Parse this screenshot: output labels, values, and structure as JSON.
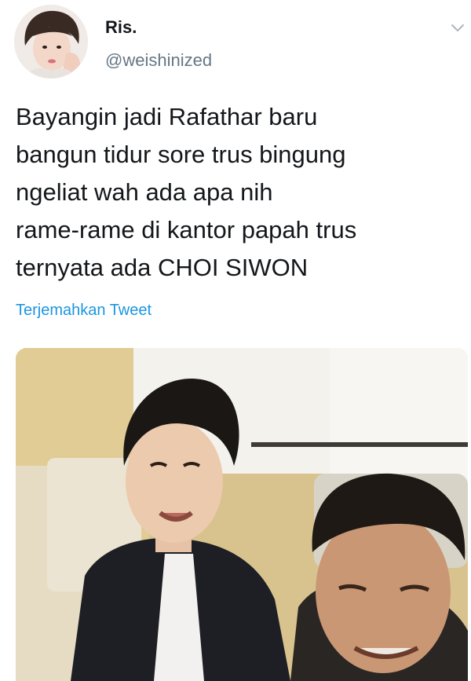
{
  "tweet": {
    "author": {
      "display_name": "Ris.",
      "handle": "@weishinized"
    },
    "text_lines": [
      "Bayangin jadi Rafathar baru",
      "bangun tidur sore trus bingung",
      "ngeliat wah ada apa nih",
      "rame-rame di kantor papah trus",
      "ternyata ada CHOI SIWON"
    ],
    "translate_label": "Terjemahkan Tweet",
    "menu_icon": "chevron-down-icon",
    "media_icon": "video-frame"
  },
  "colors": {
    "text": "#14171a",
    "secondary": "#657786",
    "link": "#1b95e0"
  }
}
